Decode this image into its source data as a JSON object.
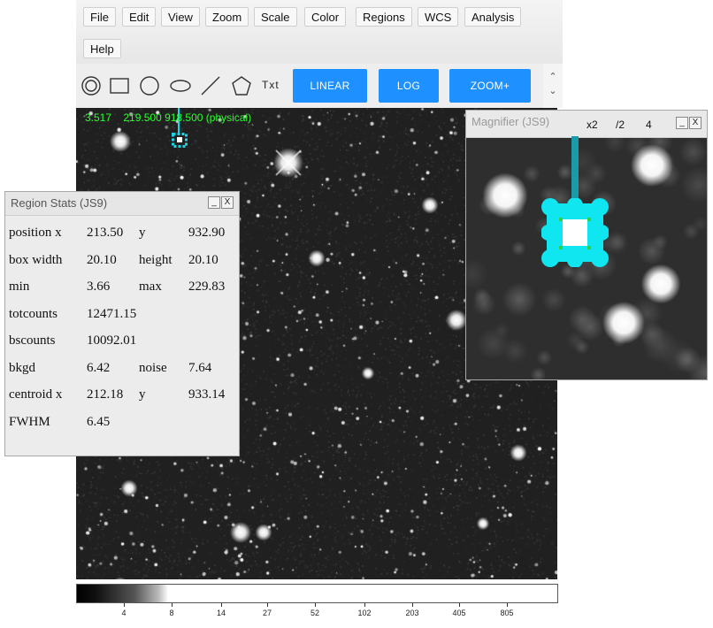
{
  "menu": [
    {
      "label": "File"
    },
    {
      "label": "Edit"
    },
    {
      "label": "View"
    },
    {
      "label": "Zoom"
    },
    {
      "label": "Scale"
    },
    {
      "label": "Color"
    },
    {
      "label": "Regions"
    },
    {
      "label": "WCS"
    },
    {
      "label": "Analysis"
    },
    {
      "label": "Help"
    }
  ],
  "toolbar": {
    "shapes": [
      "annulus-icon",
      "box-icon",
      "circle-icon",
      "ellipse-icon",
      "line-icon",
      "polygon-icon"
    ],
    "text_tool": "Txt",
    "buttons": [
      "LINEAR",
      "LOG",
      "ZOOM+"
    ],
    "accent_color": "#1e90ff"
  },
  "display": {
    "coords": "3.517    219.500 918.500 (physical)",
    "region_color": "#1bd6e6",
    "coords_color": "#2cff2c"
  },
  "colorbar": {
    "labels": [
      "4",
      "8",
      "14",
      "27",
      "52",
      "102",
      "203",
      "405",
      "805"
    ]
  },
  "region_stats": {
    "title": "Region Stats (JS9)",
    "minimize": "_",
    "close": "X",
    "rows": [
      {
        "label": "position x",
        "value": "213.50",
        "label2": "y",
        "value2": "932.90"
      },
      {
        "label": "box width",
        "value": "20.10",
        "label2": "height",
        "value2": "20.10"
      },
      {
        "label": "min",
        "value": "3.66",
        "label2": "max",
        "value2": "229.83"
      },
      {
        "label": "totcounts",
        "value": "12471.15",
        "label2": "",
        "value2": ""
      },
      {
        "label": "bscounts",
        "value": "10092.01",
        "label2": "",
        "value2": ""
      },
      {
        "label": "bkgd",
        "value": "6.42",
        "label2": "noise",
        "value2": "7.64"
      },
      {
        "label": "centroid x",
        "value": "212.18",
        "label2": "y",
        "value2": "933.14"
      },
      {
        "label": "FWHM",
        "value": "6.45",
        "label2": "",
        "value2": ""
      }
    ]
  },
  "magnifier": {
    "title": "Magnifier (JS9)",
    "zoom_in": "x2",
    "zoom_out": "/2",
    "zoom_value": "4",
    "minimize": "_",
    "close": "X"
  }
}
